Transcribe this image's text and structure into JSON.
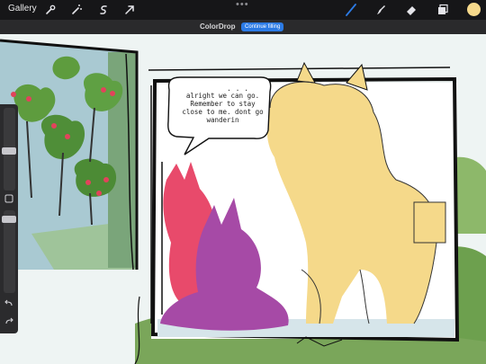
{
  "topbar": {
    "gallery_label": "Gallery",
    "more_label": "•••",
    "left_tools": [
      "wrench-icon",
      "magic-wand-icon",
      "selection-icon",
      "transform-icon"
    ],
    "right_tools": [
      "brush-icon",
      "smudge-icon",
      "eraser-icon",
      "layers-icon",
      "color-swatch"
    ],
    "active_color": "#f6d98b",
    "accent_color": "#2c7be5"
  },
  "document": {
    "name": "ColorDrop",
    "continue_filling_label": "Continue filling"
  },
  "canvas": {
    "speech_bubble_text": "alright we can go. Remember to stay close to me. dont go wanderin",
    "ellipsis": ". . ."
  },
  "sidebar": {
    "undo_icon": "undo-icon",
    "redo_icon": "redo-icon",
    "modify_icon": "modify-square-icon"
  }
}
